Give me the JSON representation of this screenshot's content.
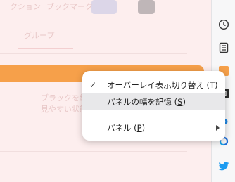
{
  "background": {
    "tab_label": "グループ",
    "top_labels": [
      "クション",
      "ブックマーク"
    ],
    "row_lines": [
      "ブラックを組織",
      "見やすい状態"
    ]
  },
  "context_menu": {
    "items": [
      {
        "label": "オーバーレイ表示切り替え",
        "accesskey": "T",
        "checked": true
      },
      {
        "label": "パネルの幅を記憶",
        "accesskey": "S",
        "checked": false,
        "hovered": true
      },
      {
        "label": "パネル",
        "accesskey": "P",
        "submenu": true
      }
    ]
  },
  "sidebar": {
    "icons": [
      "clock-icon",
      "notes-icon",
      "orange-square-icon",
      "dark-app-icon",
      "extension-icon",
      "twitter-bird-icon"
    ],
    "colors": {
      "accent_blue": "#1e88e5",
      "orange": "#f6a04a",
      "twitter": "#1d9bf0"
    }
  }
}
